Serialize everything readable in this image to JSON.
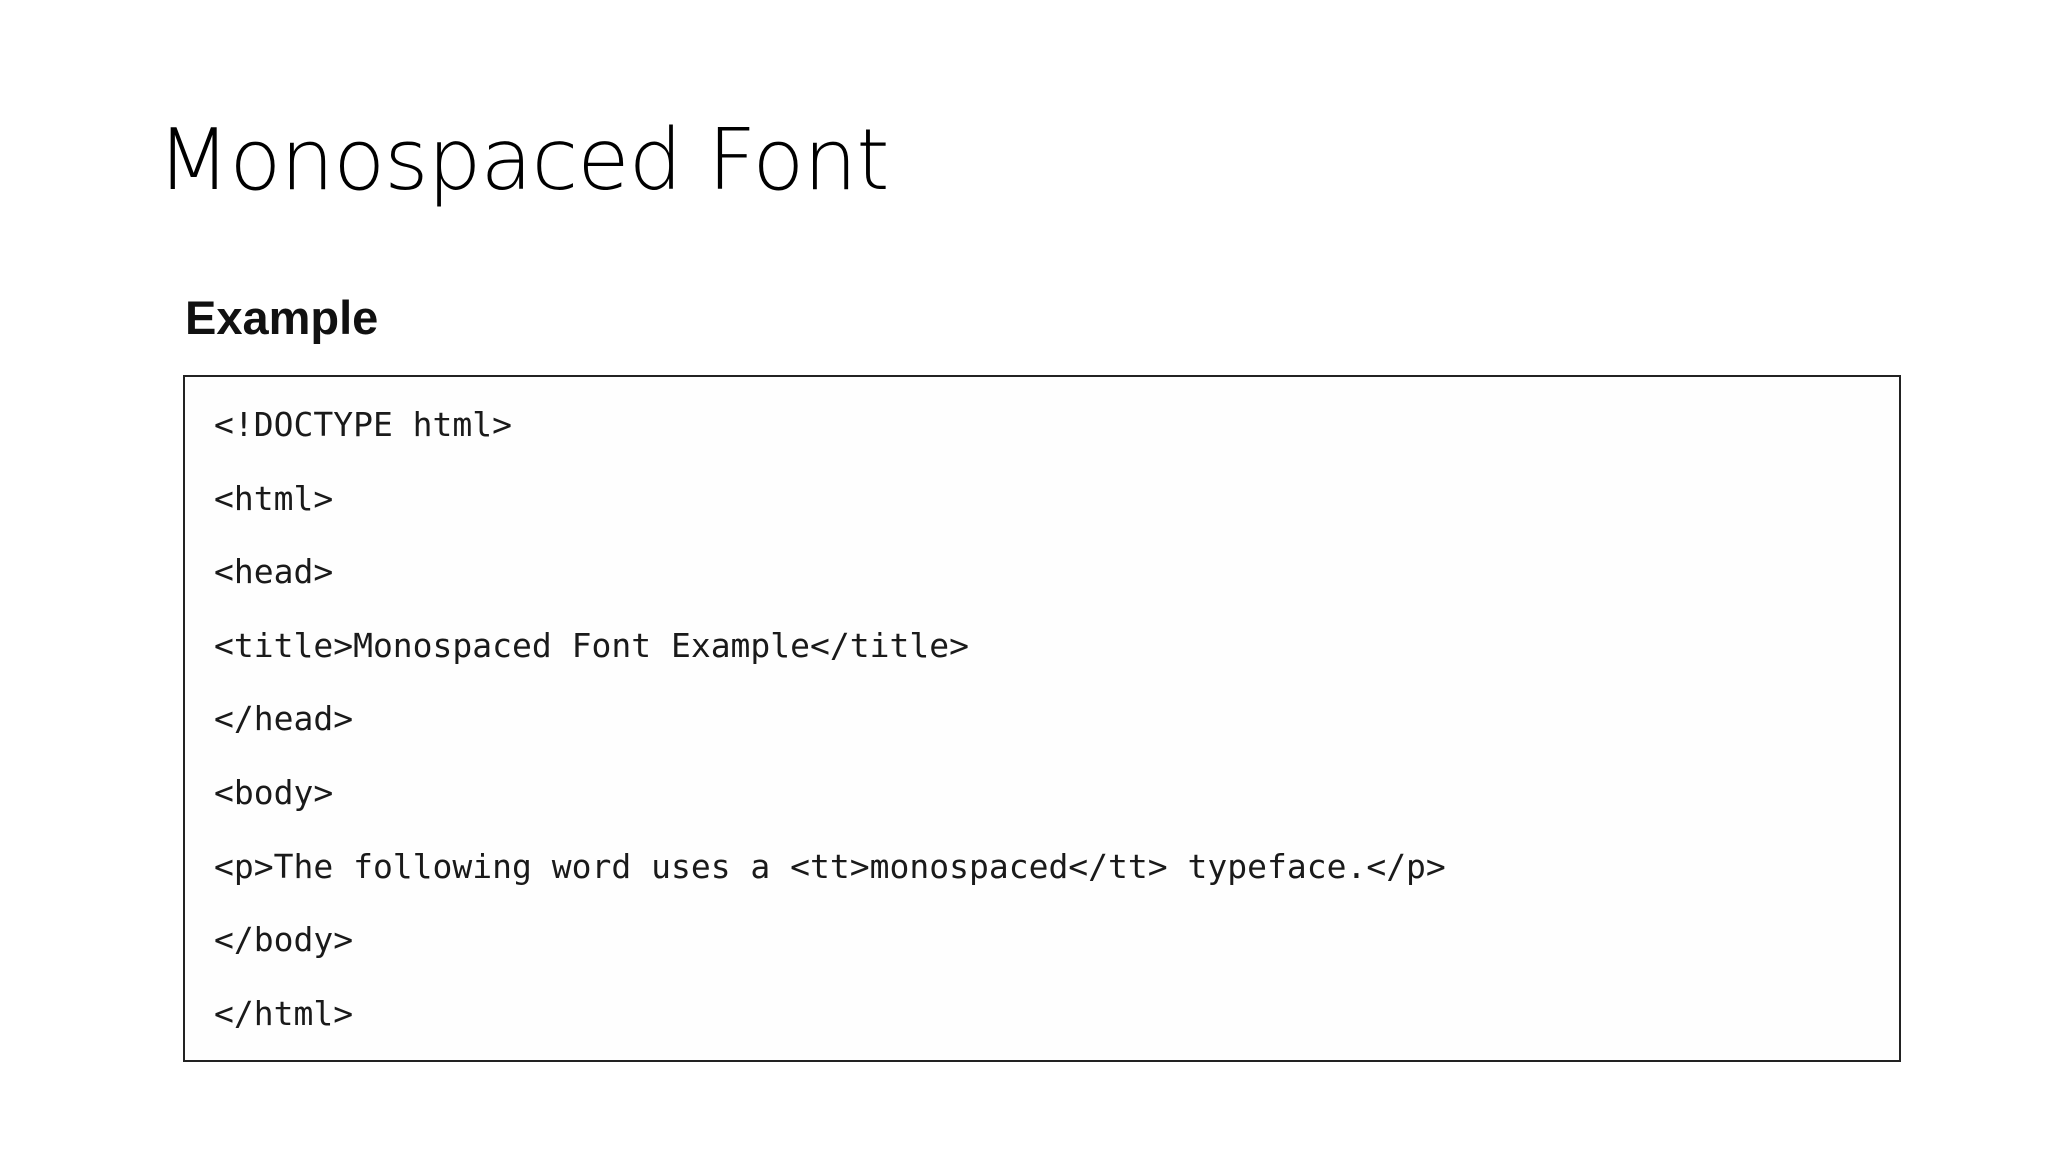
{
  "slide": {
    "title": "Monospaced Font"
  },
  "example": {
    "heading": "Example",
    "code_lines": [
      "<!DOCTYPE html>",
      "<html>",
      "<head>",
      "<title>Monospaced Font Example</title>",
      "</head>",
      "<body>",
      "<p>The following word uses a <tt>monospaced</tt> typeface.</p>",
      "</body>",
      "</html>"
    ]
  }
}
